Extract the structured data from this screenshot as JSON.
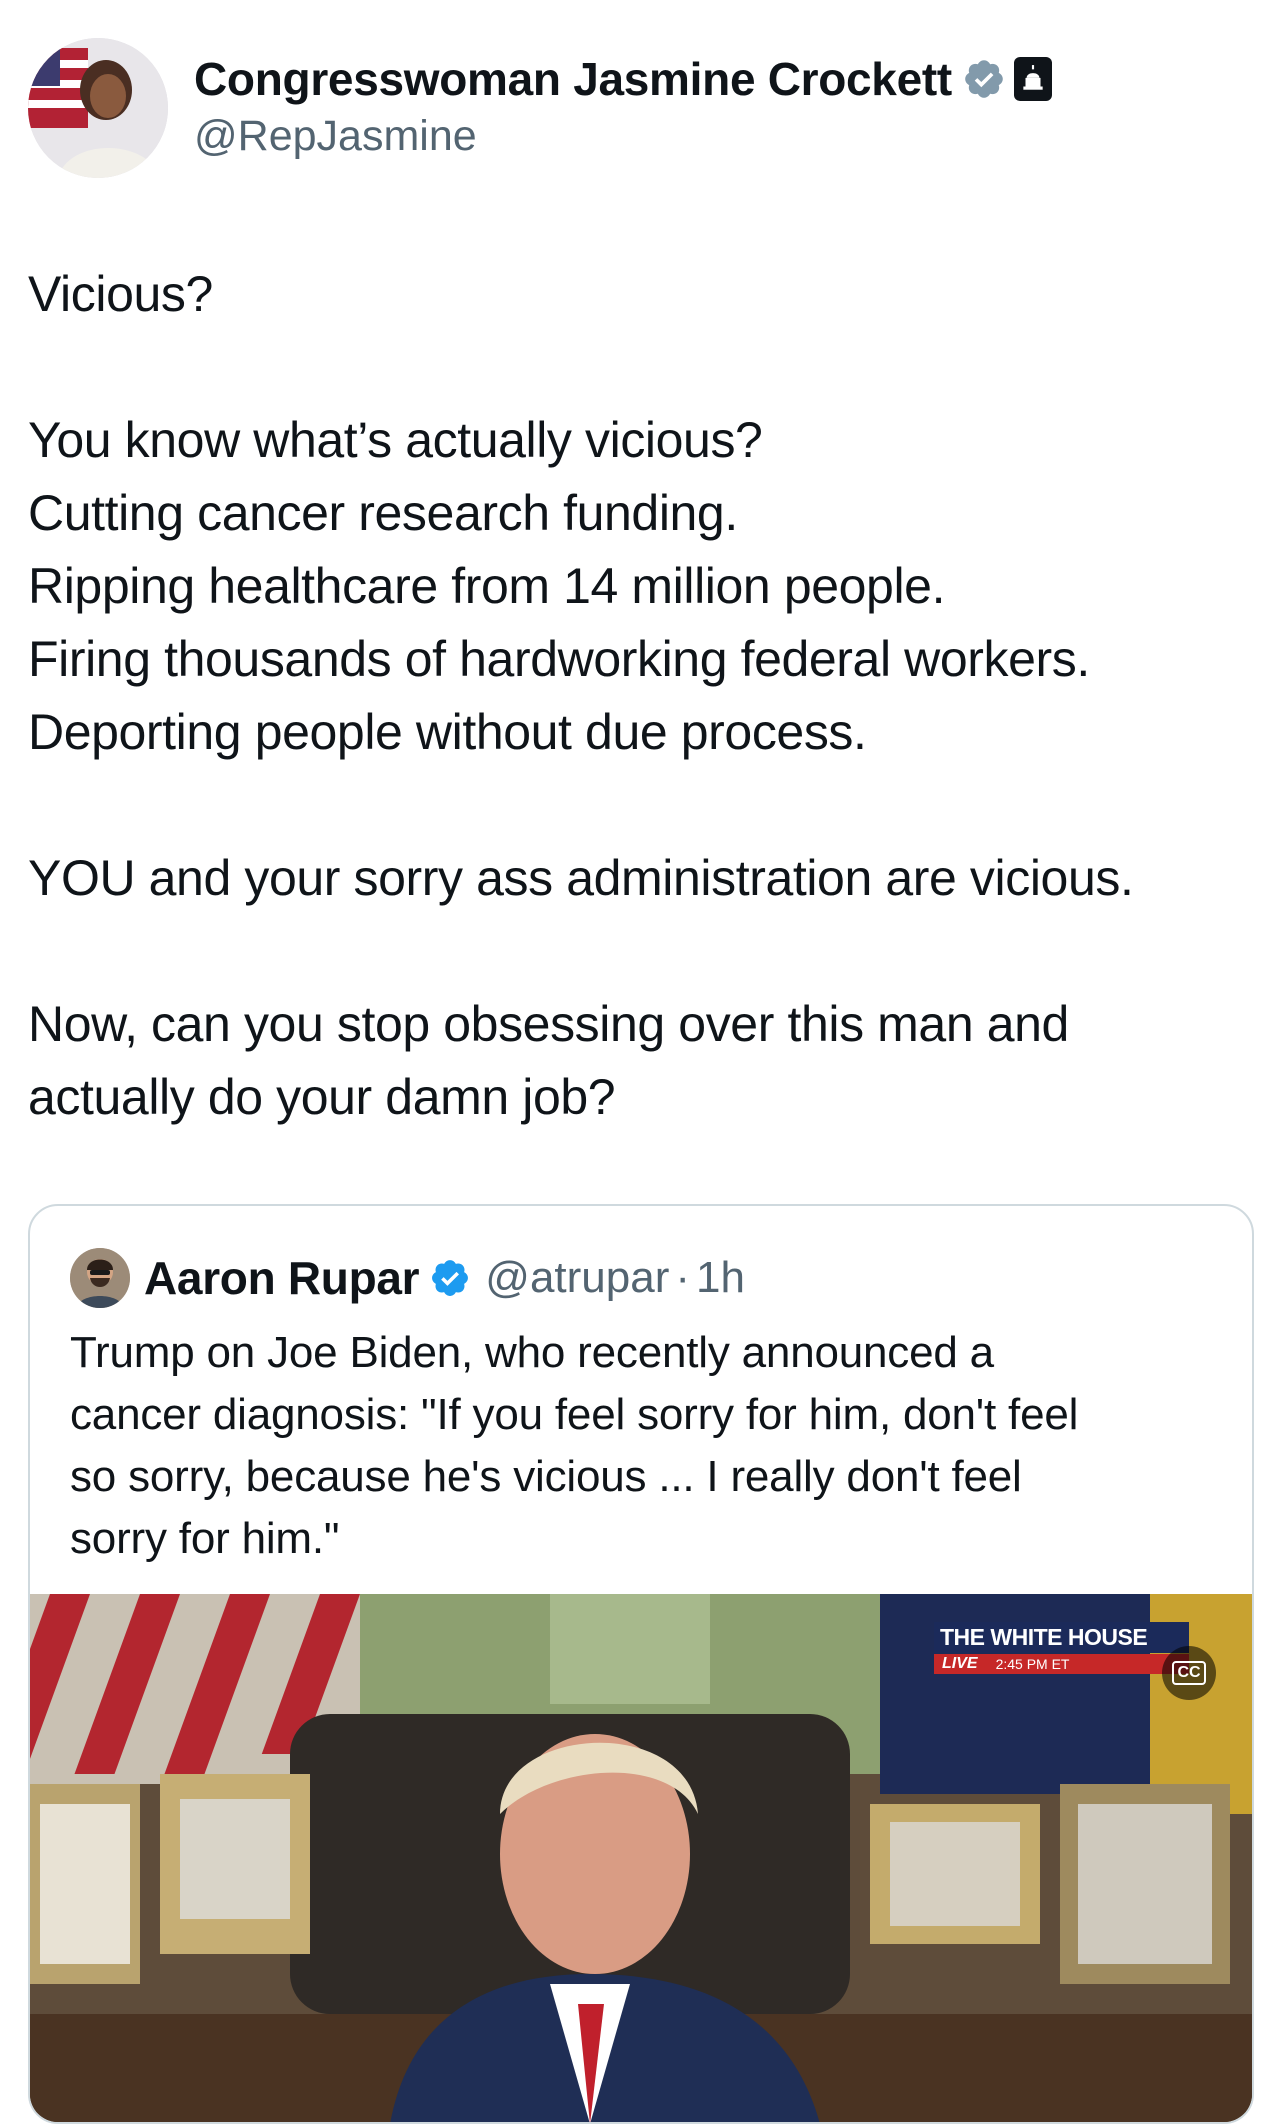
{
  "author": {
    "display_name": "Congresswoman Jasmine Crockett",
    "handle": "@RepJasmine",
    "verified_badge": "gray-verified-icon",
    "affiliation_badge": "capitol-building-icon"
  },
  "post": {
    "lines": [
      "Vicious?",
      "",
      "You know what’s actually vicious?",
      "Cutting cancer research funding.",
      "Ripping healthcare from 14 million people.",
      "Firing thousands of hardworking federal workers.",
      "Deporting people without due process.",
      "",
      "YOU and your sorry ass administration are vicious.",
      "",
      "Now, can you stop obsessing over this man and",
      "actually do your damn job?"
    ]
  },
  "quoted": {
    "display_name": "Aaron Rupar",
    "handle": "@atrupar",
    "separator": "·",
    "time": "1h",
    "verified_badge": "blue-verified-icon",
    "lines": [
      "Trump on Joe Biden, who recently announced a",
      "cancer diagnosis: \"If you feel sorry for him, don't feel",
      "so sorry, because he's vicious ... I really don't feel",
      "sorry for him.\""
    ],
    "media": {
      "overlay_title": "THE WHITE HOUSE",
      "overlay_live": "LIVE",
      "overlay_time": "2:45 PM ET",
      "cc_label": "CC"
    }
  },
  "colors": {
    "text": "#0f1419",
    "secondary": "#536471",
    "border": "#cfd9de",
    "verified_blue": "#1d9bf0",
    "verified_gray": "#829aab"
  }
}
